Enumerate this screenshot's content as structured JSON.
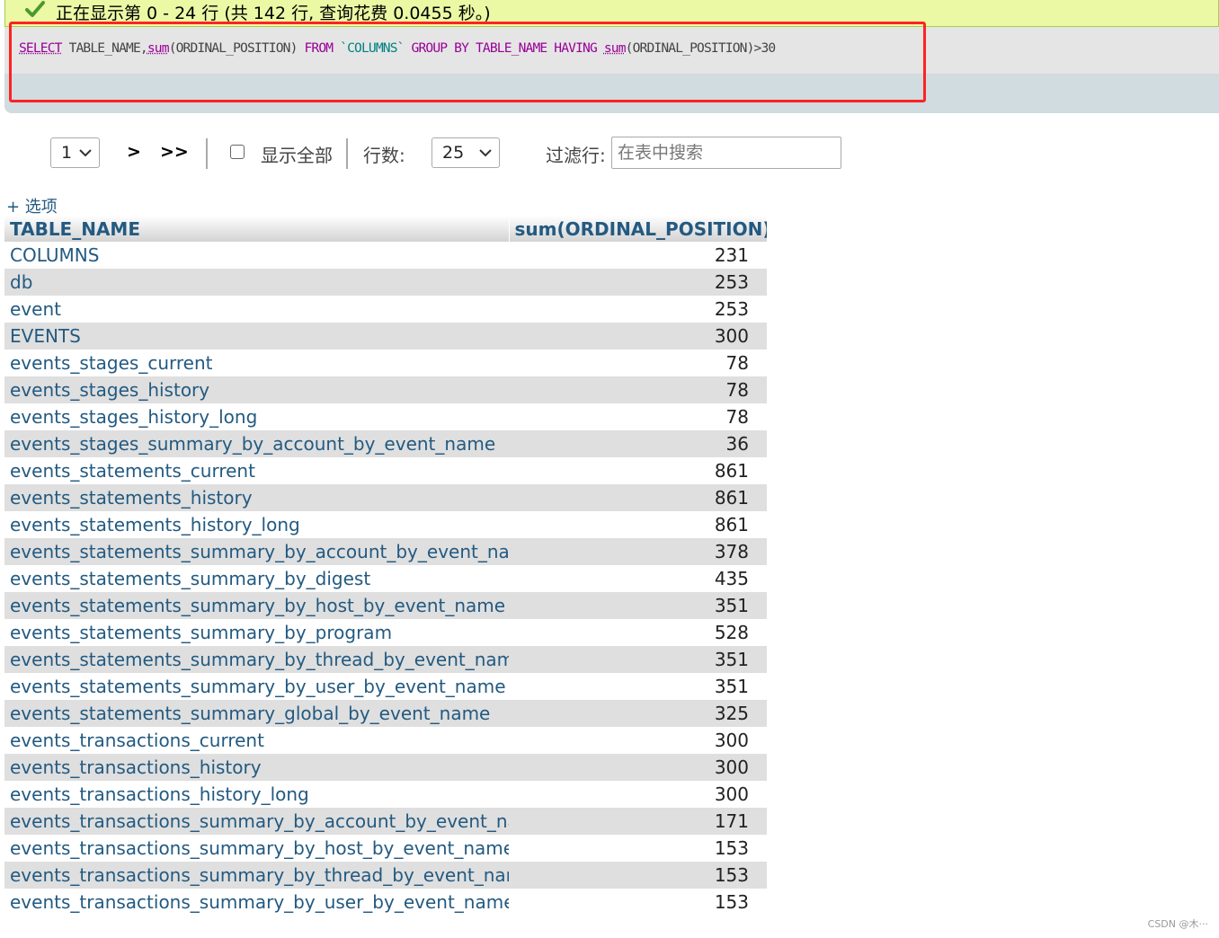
{
  "status": {
    "message": "正在显示第 0 - 24 行 (共 142 行, 查询花费 0.0455 秒。)",
    "icon": "check-icon",
    "color": "#ebf8a4"
  },
  "sql": {
    "select_kw": "SELECT",
    "col1": "TABLE_NAME,",
    "fn1": "sum",
    "arg1": "(ORDINAL_POSITION)",
    "from_kw": "FROM",
    "table": "`COLUMNS`",
    "group_kw": "GROUP",
    "by_kw": "BY",
    "group_col": "TABLE_NAME",
    "having_kw": "HAVING",
    "fn2": "sum",
    "arg2": "(ORDINAL_POSITION)>30"
  },
  "nav": {
    "page_value": "1",
    "next_label": ">",
    "last_label": ">>",
    "show_all_label": "显示全部",
    "rows_label": "行数:",
    "rows_value": "25",
    "filter_label": "过滤行:",
    "filter_placeholder": "在表中搜索"
  },
  "options_label": "+ 选项",
  "table": {
    "headers": [
      "TABLE_NAME",
      "sum(ORDINAL_POSITION)"
    ],
    "rows": [
      [
        "COLUMNS",
        "231"
      ],
      [
        "db",
        "253"
      ],
      [
        "event",
        "253"
      ],
      [
        "EVENTS",
        "300"
      ],
      [
        "events_stages_current",
        "78"
      ],
      [
        "events_stages_history",
        "78"
      ],
      [
        "events_stages_history_long",
        "78"
      ],
      [
        "events_stages_summary_by_account_by_event_name",
        "36"
      ],
      [
        "events_statements_current",
        "861"
      ],
      [
        "events_statements_history",
        "861"
      ],
      [
        "events_statements_history_long",
        "861"
      ],
      [
        "events_statements_summary_by_account_by_event_name",
        "378"
      ],
      [
        "events_statements_summary_by_digest",
        "435"
      ],
      [
        "events_statements_summary_by_host_by_event_name",
        "351"
      ],
      [
        "events_statements_summary_by_program",
        "528"
      ],
      [
        "events_statements_summary_by_thread_by_event_name",
        "351"
      ],
      [
        "events_statements_summary_by_user_by_event_name",
        "351"
      ],
      [
        "events_statements_summary_global_by_event_name",
        "325"
      ],
      [
        "events_transactions_current",
        "300"
      ],
      [
        "events_transactions_history",
        "300"
      ],
      [
        "events_transactions_history_long",
        "300"
      ],
      [
        "events_transactions_summary_by_account_by_event_name",
        "171"
      ],
      [
        "events_transactions_summary_by_host_by_event_name",
        "153"
      ],
      [
        "events_transactions_summary_by_thread_by_event_name",
        "153"
      ],
      [
        "events_transactions_summary_by_user_by_event_name",
        "153"
      ]
    ]
  },
  "watermark": "CSDN @木···",
  "colors": {
    "link": "#235a81",
    "highlight": "#ff2222",
    "row_alt": "#dfdfdf"
  }
}
